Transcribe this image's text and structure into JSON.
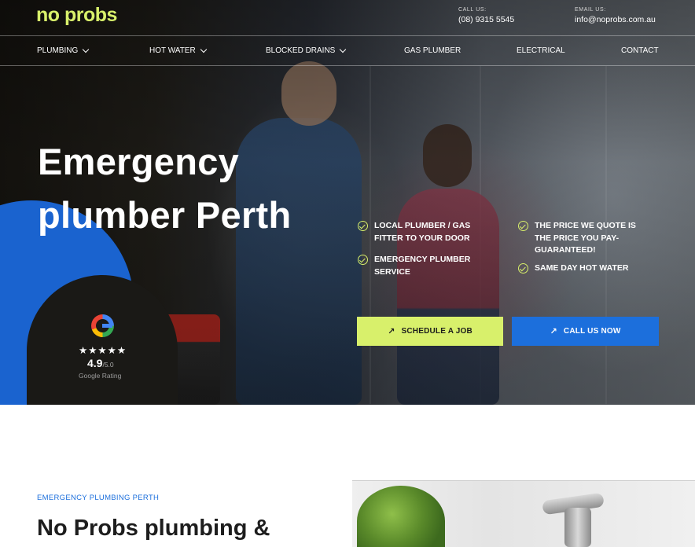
{
  "brand": {
    "logo_text": "no probs",
    "accent_color": "#d8f06b",
    "blue_color": "#1c6fdc"
  },
  "contact": {
    "phone_label": "CALL US:",
    "phone": "(08) 9315 5545",
    "email_label": "EMAIL US:",
    "email": "info@noprobs.com.au"
  },
  "nav": {
    "items": [
      {
        "label": "PLUMBING",
        "has_dropdown": true
      },
      {
        "label": "HOT WATER",
        "has_dropdown": true
      },
      {
        "label": "BLOCKED DRAINS",
        "has_dropdown": true
      },
      {
        "label": "GAS PLUMBER",
        "has_dropdown": false
      },
      {
        "label": "ELECTRICAL",
        "has_dropdown": false
      },
      {
        "label": "CONTACT",
        "has_dropdown": false
      }
    ]
  },
  "hero": {
    "title_line1": "Emergency",
    "title_line2": "plumber Perth",
    "features": [
      "LOCAL PLUMBER / GAS FITTER TO YOUR DOOR",
      "EMERGENCY PLUMBER SERVICE",
      "THE PRICE WE QUOTE IS THE PRICE YOU PAY- GUARANTEED!",
      "SAME DAY HOT WATER"
    ],
    "buttons": {
      "schedule": "SCHEDULE A JOB",
      "call": "CALL US NOW"
    }
  },
  "rating": {
    "stars": "★★★★★",
    "score": "4.9",
    "out_of": "/5.0",
    "label": "Google Rating",
    "star_count": 5
  },
  "section": {
    "eyebrow": "EMERGENCY PLUMBING PERTH",
    "title": "No Probs plumbing &"
  }
}
